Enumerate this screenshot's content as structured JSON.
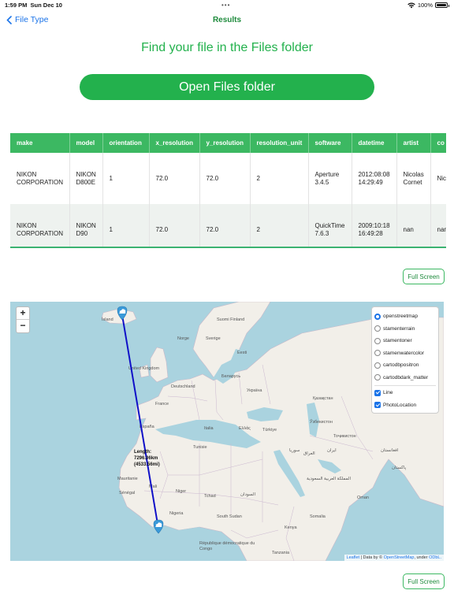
{
  "status_bar": {
    "time": "1:59 PM",
    "date": "Sun Dec 10",
    "battery": "100%",
    "icons": [
      "wifi-icon",
      "battery-icon"
    ]
  },
  "nav": {
    "back_label": "File Type",
    "title": "Results"
  },
  "headline": "Find your file in the Files folder",
  "open_button": "Open Files folder",
  "table": {
    "headers": [
      "make",
      "model",
      "orientation",
      "x_resolution",
      "y_resolution",
      "resolution_unit",
      "software",
      "datetime",
      "artist",
      "co"
    ],
    "rows": [
      [
        "NIKON CORPORATION",
        "NIKON D800E",
        "1",
        "72.0",
        "72.0",
        "2",
        "Aperture 3.4.5",
        "2012:08:08 14:29:49",
        "Nicolas Cornet",
        "Nic Co"
      ],
      [
        "NIKON CORPORATION",
        "NIKON D90",
        "1",
        "72.0",
        "72.0",
        "2",
        "QuickTime 7.6.3",
        "2009:10:18 16:49:28",
        "nan",
        "nan"
      ]
    ]
  },
  "full_screen_label": "Full Screen",
  "map": {
    "zoom_in": "+",
    "zoom_out": "−",
    "layers": {
      "base": [
        "openstreetmap",
        "stamenterrain",
        "stamentoner",
        "stamenwatercolor",
        "cartodbpositron",
        "cartodbdark_matter"
      ],
      "selected_base": "openstreetmap",
      "overlays": [
        "Line",
        "PhotoLocation"
      ]
    },
    "length_label": {
      "title": "Length:",
      "km": "7296.06km",
      "mi": "(4533.56mi)"
    },
    "place_labels": [
      "Ísland",
      "Suomi Finland",
      "Norge",
      "Sverige",
      "Eesti",
      "United Kingdom",
      "Deutschland",
      "Беларусь",
      "Україна",
      "France",
      "España",
      "Italia",
      "Ελλάς",
      "Türkiye",
      "Қазақстан",
      "Ўзбекистон",
      "Тоҷикистон",
      "Tunisie",
      "سوريا",
      "العراق",
      "ایران",
      "Mauritanie",
      "Mali",
      "Niger",
      "Tchad",
      "السودان",
      "Nigeria",
      "South Sudan",
      "Somalia",
      "Sénégal",
      "Kenya",
      "République démocratique du Congo",
      "Tanzania",
      "افغانستان",
      "پاکستان",
      "Oman",
      "المملكة العربية السعودية"
    ],
    "attribution": {
      "leaflet": "Leaflet",
      "sep": " | Data by © ",
      "osm": "OpenStreetMap",
      "under": ", under ",
      "odbl": "ODbL."
    },
    "colors": {
      "water": "#aad3df",
      "land": "#f2efe9",
      "line": "#1010c8",
      "marker": "#3a9ad9"
    }
  }
}
